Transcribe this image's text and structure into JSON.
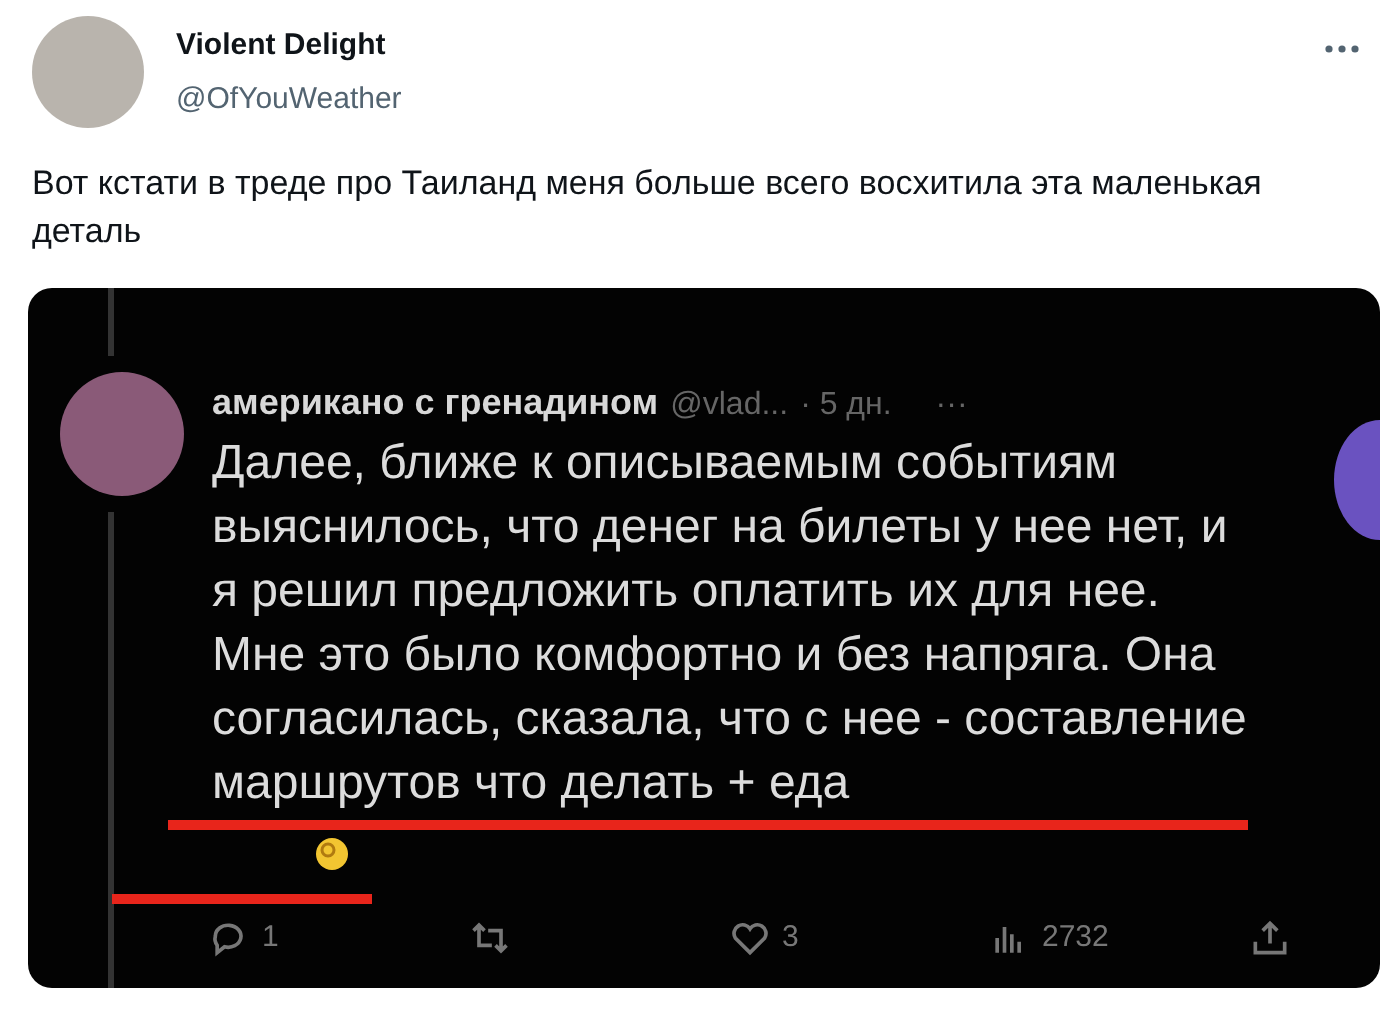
{
  "author": {
    "name": "Violent Delight",
    "handle": "@OfYouWeather"
  },
  "tweet_text": "Вот кстати в треде про Таиланд меня больше всего восхитила эта маленькая деталь",
  "embedded_tweet": {
    "author_name": "американо с гренадином",
    "handle": "@vlad...",
    "time": "· 5 дн.",
    "more": "···",
    "text": "Далее, ближе к описываемым событиям выяснилось, что денег на билеты у нее нет, и я решил предложить оплатить их для нее. Мне это было комфортно и без напряга. Она согласилась, сказала, что с нее - составление маршрутов что делать + еда",
    "actions": [
      {
        "kind": "reply",
        "count": "1"
      },
      {
        "kind": "retweet"
      },
      {
        "kind": "like",
        "count": "3"
      },
      {
        "kind": "views",
        "count": "2732"
      },
      {
        "kind": "share"
      }
    ]
  }
}
